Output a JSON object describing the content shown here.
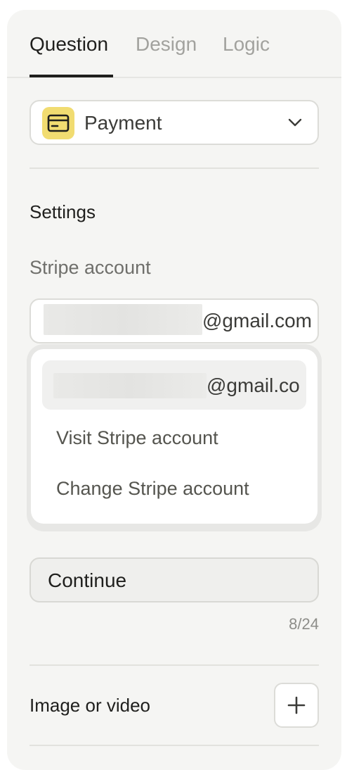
{
  "tabs": {
    "question": "Question",
    "design": "Design",
    "logic": "Logic"
  },
  "question_type": {
    "label": "Payment",
    "icon": "credit-card-icon",
    "accent": "#f1dc71"
  },
  "settings": {
    "title": "Settings"
  },
  "stripe": {
    "label": "Stripe account",
    "selected_email_suffix": "@gmail.com"
  },
  "dropdown": {
    "current_email_suffix": "@gmail.co",
    "visit_label": "Visit Stripe account",
    "change_label": "Change Stripe account"
  },
  "button_text": {
    "value": "Continue",
    "count": "8/24"
  },
  "media": {
    "label": "Image or video",
    "icon": "plus-icon"
  }
}
